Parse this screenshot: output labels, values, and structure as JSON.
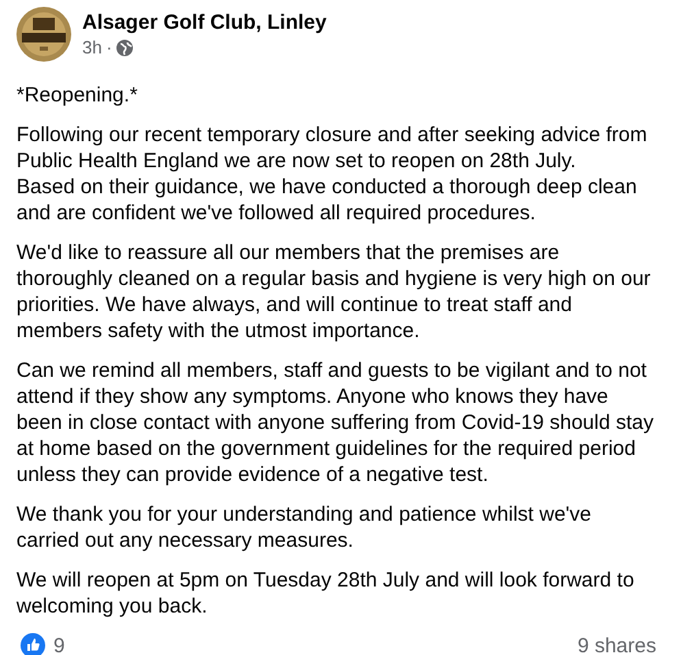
{
  "post": {
    "author": "Alsager Golf Club, Linley",
    "time": "3h",
    "separator": "·",
    "paragraphs": [
      "*Reopening.*",
      "Following our recent temporary closure and after seeking advice from Public Health England we are now set to reopen on 28th July.\nBased on their guidance, we have conducted a thorough deep clean and are confident we've followed all required procedures.",
      "We'd like to reassure all our members that the premises are thoroughly cleaned on a regular basis and hygiene is very high on our priorities. We have always, and will continue to treat staff and members safety with the utmost importance.",
      "Can we remind all members, staff and guests to be vigilant and to not attend if they show any symptoms. Anyone who knows they have been in close contact with anyone suffering from Covid-19 should stay at home based on the government guidelines for the required period unless they can provide evidence of a negative test.",
      "We thank you for your understanding and patience whilst we've carried out any necessary measures.",
      "We will reopen at 5pm on Tuesday 28th July and will look forward to welcoming you back."
    ]
  },
  "footer": {
    "reactions": "9",
    "shares": "9 shares"
  }
}
